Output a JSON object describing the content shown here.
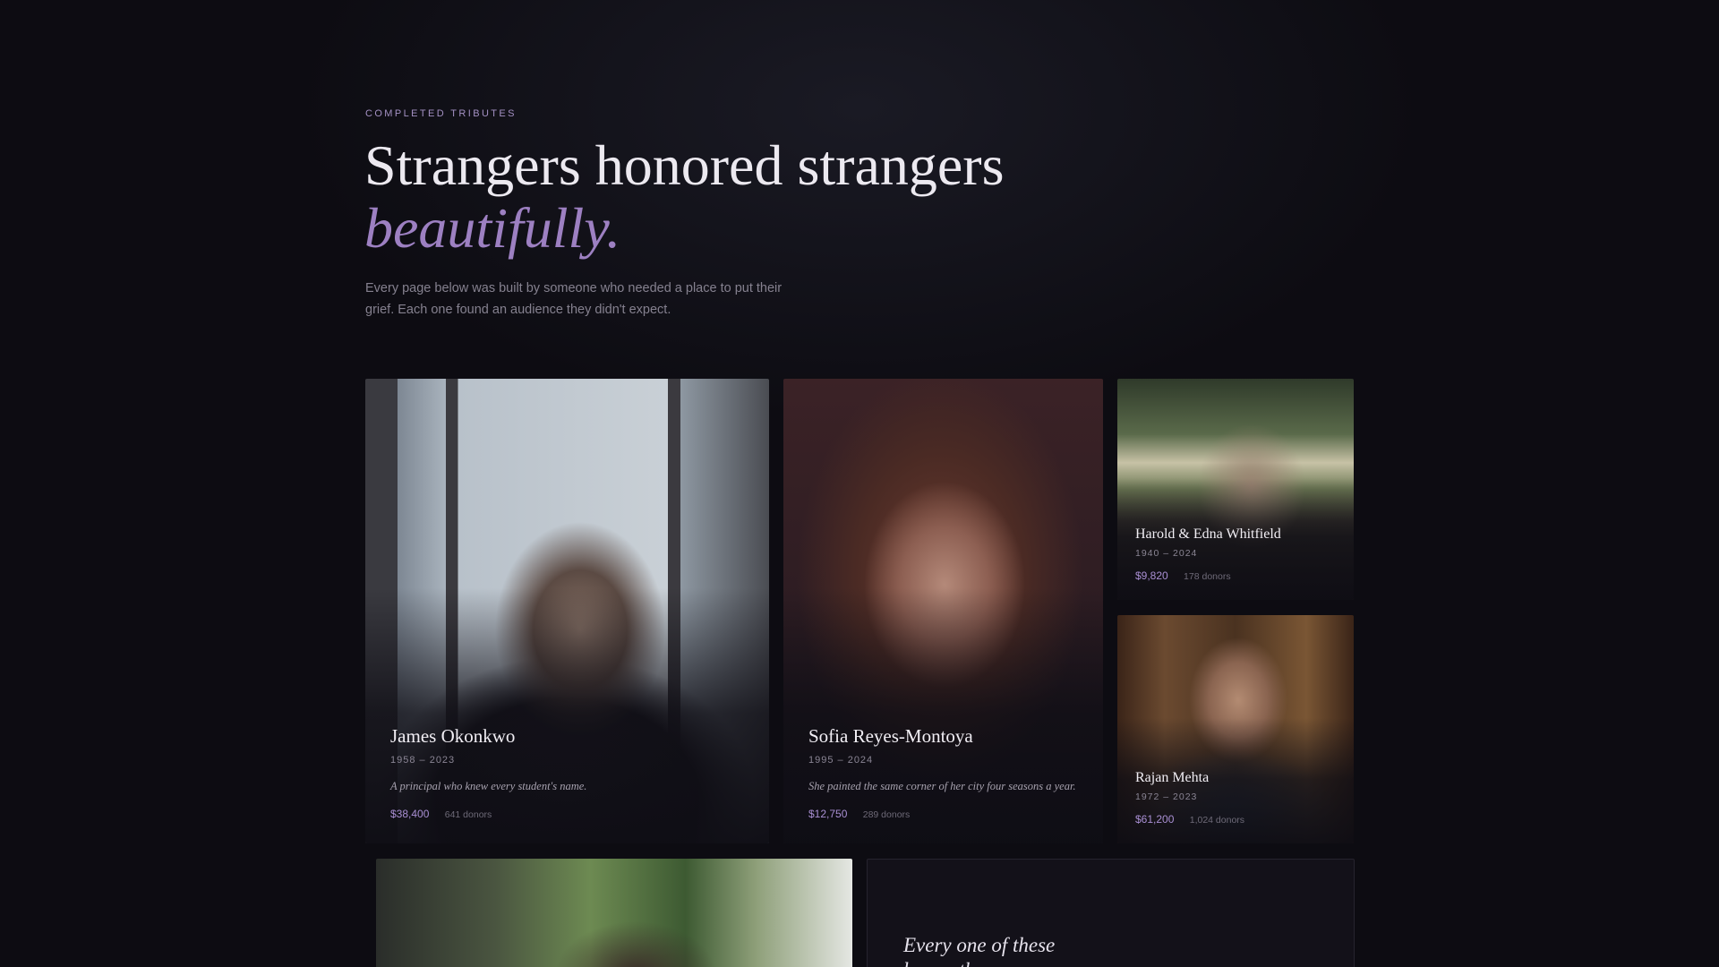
{
  "hero": {
    "eyebrow": "COMPLETED TRIBUTES",
    "headline_line1": "Strangers honored strangers",
    "headline_line2": "beautifully.",
    "intro": "Every page below was built by someone who needed a place to put their grief. Each one found an audience they didn't expect."
  },
  "tributes": [
    {
      "name": "James Okonkwo",
      "dates": "1958 – 2023",
      "quote": "A principal who knew every student's name.",
      "amount": "$38,400",
      "donors": "641 donors",
      "image": "portrait-older-man-window"
    },
    {
      "name": "Sofia Reyes-Montoya",
      "dates": "1995 – 2024",
      "quote": "She painted the same corner of her city four seasons a year.",
      "amount": "$12,750",
      "donors": "289 donors",
      "image": "portrait-young-woman-glasses-paint"
    },
    {
      "name": "Harold & Edna Whitfield",
      "dates": "1940 – 2024",
      "amount": "$9,820",
      "donors": "178 donors",
      "image": "elderly-couple-porch"
    },
    {
      "name": "Rajan Mehta",
      "dates": "1972 – 2023",
      "amount": "$61,200",
      "donors": "1,024 donors",
      "image": "portrait-man-warm-light"
    },
    {
      "image": "portrait-outdoor-greenery"
    }
  ],
  "bottom_panel": {
    "text": "Every one of these began the same way"
  }
}
